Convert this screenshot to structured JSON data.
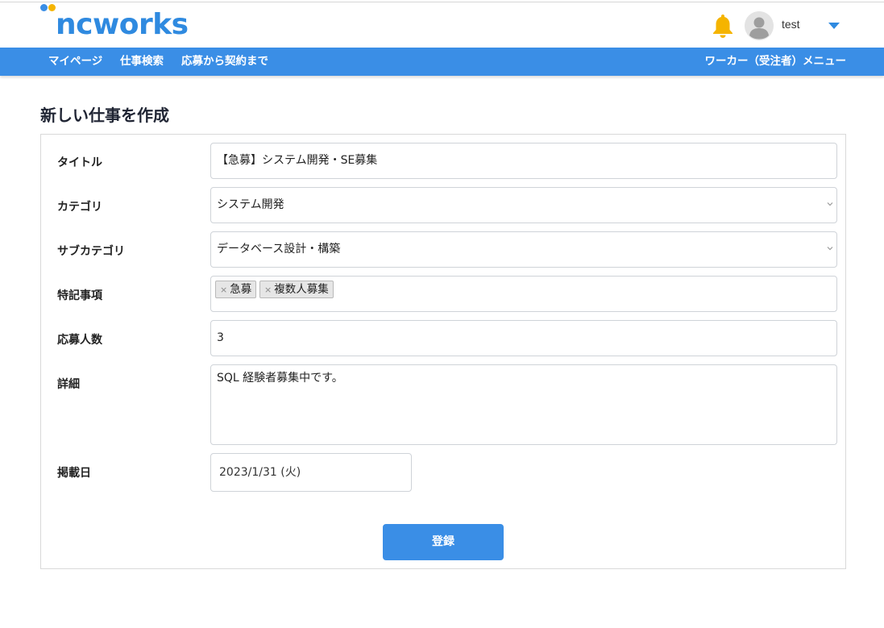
{
  "brand": {
    "logo_text": "ncworks",
    "dot_colors": [
      "#3a8ee6",
      "#f5b400"
    ]
  },
  "header": {
    "user_name": "test",
    "icons": [
      "bell-icon",
      "user-avatar-icon",
      "caret-down-icon"
    ]
  },
  "nav": {
    "items": [
      {
        "label": "マイページ"
      },
      {
        "label": "仕事検索"
      },
      {
        "label": "応募から契約まで"
      }
    ],
    "worker_menu": "ワーカー（受注者）メニュー"
  },
  "page": {
    "title": "新しい仕事を作成"
  },
  "form": {
    "title": {
      "label": "タイトル",
      "value": "【急募】システム開発・SE募集"
    },
    "category": {
      "label": "カテゴリ",
      "value": "システム開発"
    },
    "subcategory": {
      "label": "サブカテゴリ",
      "value": "データベース設計・構築"
    },
    "notes": {
      "label": "特記事項",
      "tags": [
        "急募",
        "複数人募集"
      ]
    },
    "applicants": {
      "label": "応募人数",
      "value": "3"
    },
    "detail": {
      "label": "詳細",
      "value": "SQL 経験者募集中です。"
    },
    "publish_date": {
      "label": "掲載日",
      "value": "2023/1/31 (火)"
    },
    "submit_label": "登録"
  },
  "colors": {
    "primary": "#3a8ee6",
    "bell": "#f5b400",
    "border": "#d9d9d9"
  }
}
